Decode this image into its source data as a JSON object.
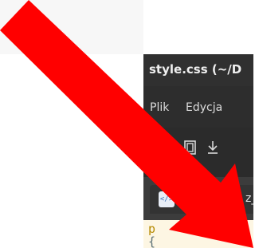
{
  "window": {
    "title": "style.css (~/D"
  },
  "menubar": {
    "items": [
      "Plik",
      "Edycja"
    ]
  },
  "toolbar": {
    "buttons": [
      "open-icon",
      "save-icon"
    ]
  },
  "tab": {
    "icon_text": "</>",
    "label": "z_"
  },
  "editor": {
    "lines": [
      "p",
      "{"
    ]
  },
  "overlay": {
    "arrow_color": "#ff0000"
  },
  "colors": {
    "window_bg": "#2b2b2b",
    "editor_bg": "#fdf6e3",
    "topstrip_bg": "#f7f7f7"
  }
}
